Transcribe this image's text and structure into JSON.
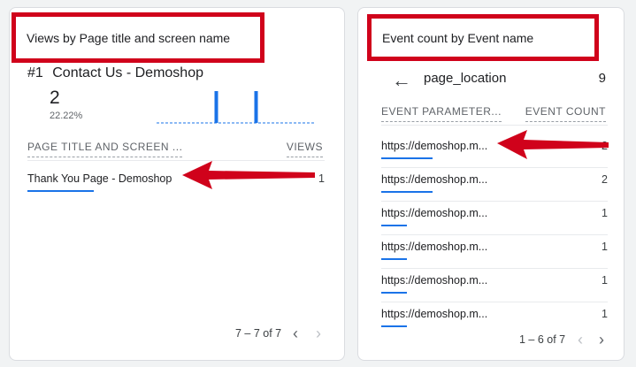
{
  "left_card": {
    "title": "Views by Page title and screen name",
    "top_rank": "#1",
    "top_name": "Contact Us - Demoshop",
    "top_value": "2",
    "top_percent": "22.22%",
    "col_dimension": "PAGE TITLE AND SCREEN ...",
    "col_metric": "VIEWS",
    "rows": [
      {
        "label": "Thank You Page - Demoshop",
        "value": "1",
        "bar_fraction": 1.0
      }
    ],
    "pager_text": "7 – 7 of 7",
    "sparkline": [
      0,
      0,
      0,
      0,
      0,
      0,
      0,
      0,
      0,
      0,
      1,
      0,
      0,
      0,
      0,
      0,
      0,
      1,
      0,
      0,
      0,
      0,
      0,
      0,
      0,
      0,
      0,
      0
    ]
  },
  "right_card": {
    "title": "Event count by Event name",
    "back_icon": "arrow-left-icon",
    "dimension_title": "page_location",
    "dimension_count": "9",
    "col_dimension": "EVENT PARAMETER...",
    "col_metric": "EVENT COUNT",
    "rows": [
      {
        "label": "https://demoshop.m...",
        "value": "2",
        "bar_fraction": 1.0
      },
      {
        "label": "https://demoshop.m...",
        "value": "2",
        "bar_fraction": 1.0
      },
      {
        "label": "https://demoshop.m...",
        "value": "1",
        "bar_fraction": 0.5
      },
      {
        "label": "https://demoshop.m...",
        "value": "1",
        "bar_fraction": 0.5
      },
      {
        "label": "https://demoshop.m...",
        "value": "1",
        "bar_fraction": 0.5
      },
      {
        "label": "https://demoshop.m...",
        "value": "1",
        "bar_fraction": 0.5
      }
    ],
    "pager_text": "1 – 6 of 7"
  },
  "colors": {
    "accent_blue": "#1a73e8",
    "annotation_red": "#d0021b"
  }
}
